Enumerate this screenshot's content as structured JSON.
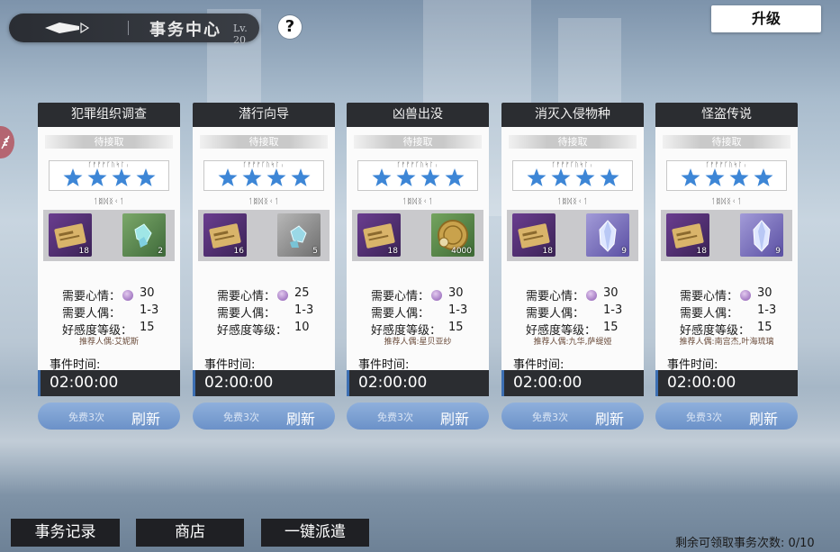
{
  "header": {
    "title": "事务中心",
    "level": "Lv. 20",
    "help_label": "?",
    "upgrade_label": "升级"
  },
  "cards": [
    {
      "title": "犯罪组织调查",
      "status": "待接取",
      "rank_runes_top": "ᚴᚠᚡᚠᚵᚢᛋᛚᛧ",
      "rank_runes_bottom": "ᛐᛥᛞᛝᚲᛐ",
      "stars": 4,
      "rewards": [
        {
          "icon": "commission-ticket-icon",
          "count": "18"
        },
        {
          "icon": "green-crystal-icon",
          "count": "2"
        }
      ],
      "mood_label": "需要心情：",
      "mood_value": "30",
      "dolls_label": "需要人偶：",
      "dolls_value": "1-3",
      "affinity_label": "好感度等级：",
      "affinity_value": "15",
      "recommend": "推荐人偶:艾妮斯",
      "time_label": "事件时间:",
      "time_value": "02:00:00",
      "refresh_free": "免费3次",
      "refresh_label": "刷新"
    },
    {
      "title": "潜行向导",
      "status": "待接取",
      "rank_runes_top": "ᚴᚠᚡᚠᚵᚢᛋᛚᛧ",
      "rank_runes_bottom": "ᛐᛥᛞᛝᚲᛐ",
      "stars": 4,
      "rewards": [
        {
          "icon": "commission-ticket-icon",
          "count": "16"
        },
        {
          "icon": "gray-crystal-icon",
          "count": "5"
        }
      ],
      "mood_label": "需要心情：",
      "mood_value": "25",
      "dolls_label": "需要人偶：",
      "dolls_value": "1-3",
      "affinity_label": "好感度等级：",
      "affinity_value": "10",
      "recommend": "",
      "time_label": "事件时间:",
      "time_value": "02:00:00",
      "refresh_free": "免费3次",
      "refresh_label": "刷新"
    },
    {
      "title": "凶兽出没",
      "status": "待接取",
      "rank_runes_top": "ᚴᚠᚡᚠᚵᚢᛋᛚᛧ",
      "rank_runes_bottom": "ᛐᛥᛞᛝᚲᛐ",
      "stars": 4,
      "rewards": [
        {
          "icon": "commission-ticket-icon",
          "count": "18"
        },
        {
          "icon": "gold-coin-icon",
          "count": "4000"
        }
      ],
      "mood_label": "需要心情：",
      "mood_value": "30",
      "dolls_label": "需要人偶：",
      "dolls_value": "1-3",
      "affinity_label": "好感度等级：",
      "affinity_value": "15",
      "recommend": "推荐人偶:星贝亚纱",
      "time_label": "事件时间:",
      "time_value": "02:00:00",
      "refresh_free": "免费3次",
      "refresh_label": "刷新"
    },
    {
      "title": "消灭入侵物种",
      "status": "待接取",
      "rank_runes_top": "ᚴᚠᚡᚠᚵᚢᛋᛚᛧ",
      "rank_runes_bottom": "ᛐᛥᛞᛝᚲᛐ",
      "stars": 4,
      "rewards": [
        {
          "icon": "commission-ticket-icon",
          "count": "18"
        },
        {
          "icon": "purple-crystal-icon",
          "count": "9"
        }
      ],
      "mood_label": "需要心情：",
      "mood_value": "30",
      "dolls_label": "需要人偶：",
      "dolls_value": "1-3",
      "affinity_label": "好感度等级：",
      "affinity_value": "15",
      "recommend": "推荐人偶:九华,萨缇娅",
      "time_label": "事件时间:",
      "time_value": "02:00:00",
      "refresh_free": "免费3次",
      "refresh_label": "刷新"
    },
    {
      "title": "怪盗传说",
      "status": "待接取",
      "rank_runes_top": "ᚴᚠᚡᚠᚵᚢᛋᛚᛧ",
      "rank_runes_bottom": "ᛐᛥᛞᛝᚲᛐ",
      "stars": 4,
      "rewards": [
        {
          "icon": "commission-ticket-icon",
          "count": "18"
        },
        {
          "icon": "purple-crystal-icon",
          "count": "9"
        }
      ],
      "mood_label": "需要心情：",
      "mood_value": "30",
      "dolls_label": "需要人偶：",
      "dolls_value": "1-3",
      "affinity_label": "好感度等级：",
      "affinity_value": "15",
      "recommend": "推荐人偶:南宫杰,叶海琉璃",
      "time_label": "事件时间:",
      "time_value": "02:00:00",
      "refresh_free": "免费3次",
      "refresh_label": "刷新"
    }
  ],
  "footer": {
    "records_label": "事务记录",
    "shop_label": "商店",
    "dispatch_label": "一键派遣",
    "remaining_text": "剩余可领取事务次数: 0/10"
  },
  "colors": {
    "accent_blue": "#3c6fb3",
    "star_blue": "#3d86d6",
    "dark_panel": "#2b2d31"
  }
}
